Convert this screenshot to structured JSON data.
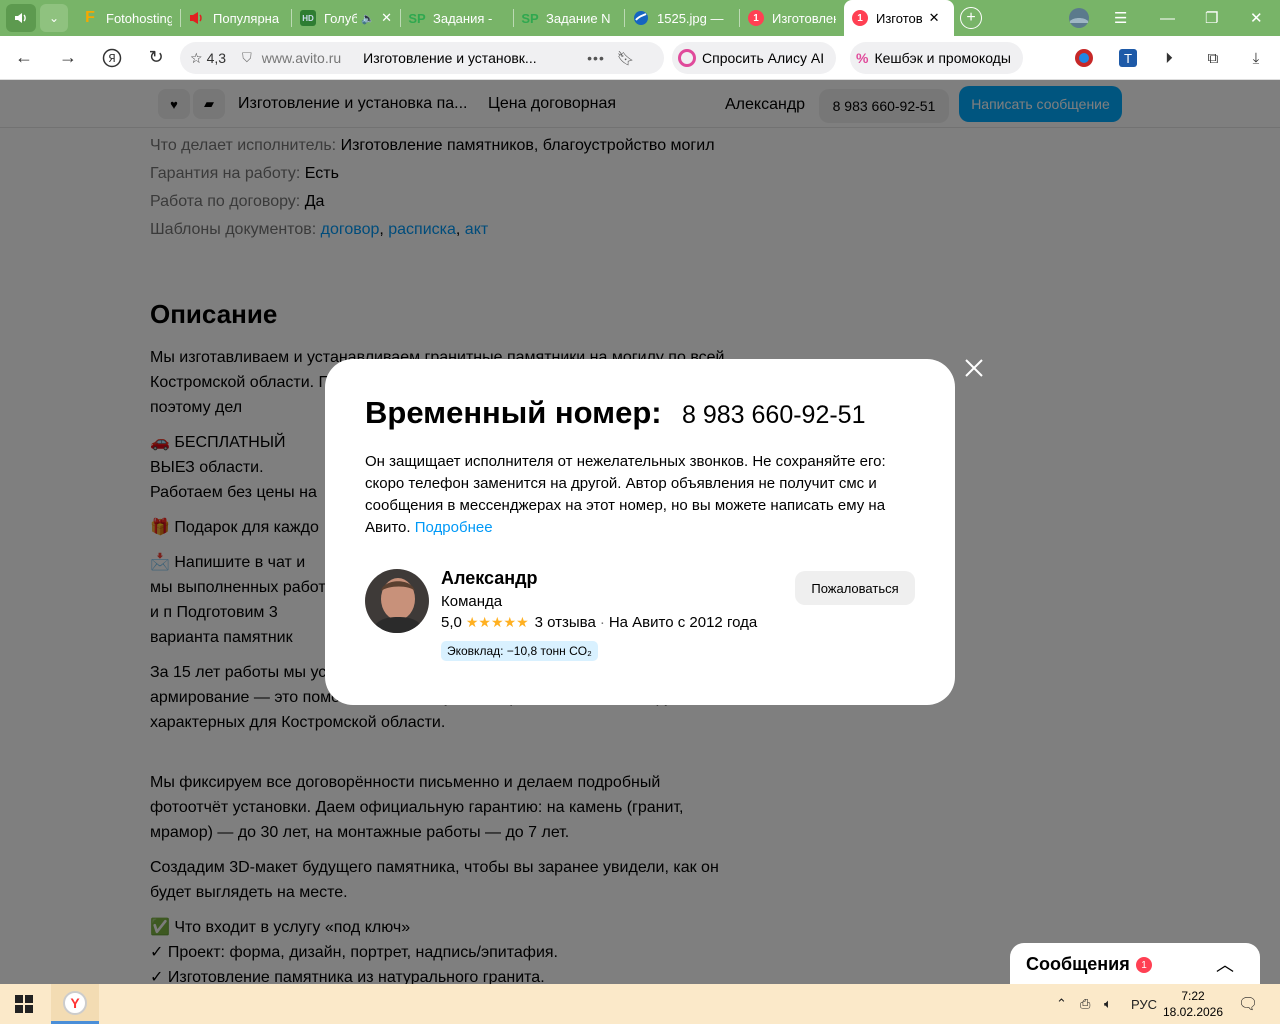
{
  "browser": {
    "tabs": [
      {
        "label": "Fotohosting",
        "favicon": "F",
        "color": "#f6a800"
      },
      {
        "label": "Популярна",
        "favicon": "speaker",
        "color": "#e02020"
      },
      {
        "label": "Голуб",
        "favicon": "HD",
        "color": "#2e7d32"
      },
      {
        "label": "Задания - ",
        "favicon": "SP",
        "color": "#2fa84f"
      },
      {
        "label": "Задание N",
        "favicon": "SP",
        "color": "#2fa84f"
      },
      {
        "label": "1525.jpg —",
        "favicon": "wave",
        "color": "#1565c0"
      },
      {
        "label": "Изготовлен",
        "favicon": "1",
        "color": "#ff4053"
      },
      {
        "label": "Изготов",
        "favicon": "1",
        "color": "#ff4053",
        "active": true
      }
    ],
    "rating": "4,3",
    "domain": "www.avito.ru",
    "page_title": "Изготовление и установк...",
    "alisa_label": "Спросить Алису AI",
    "cashback_label": "Кешбэк и промокоды"
  },
  "sticky": {
    "title": "Изготовление и установка па...",
    "price": "Цена договорная",
    "seller": "Александр",
    "phone": "8 983 660-92-51",
    "write_label": "Написать сообщение"
  },
  "props": [
    {
      "key": "Что делает исполнитель:",
      "value": "Изготовление памятников, благоустройство могил"
    },
    {
      "key": "Гарантия на работу:",
      "value": "Есть"
    },
    {
      "key": "Работа по договору:",
      "value": "Да"
    }
  ],
  "templates": {
    "key": "Шаблоны документов:",
    "links": [
      "договор",
      "расписка",
      "акт"
    ]
  },
  "description": {
    "heading": "Описание",
    "p1": "Мы изготавливаем и устанавливаем гранитные памятники на могилу по всей Костромской области. Понимаем, насколько важно принять правильное решение, поэтому дел",
    "p2": "🚗 БЕСПЛАТНЫЙ ВЫЕЗ области. Работаем без цены на ~20% сохрани",
    "p3": "🎁 Подарок для каждо",
    "p4": "📩 Напишите в чат и мы выполненных работ и п Подготовим 3 варианта памятник достойным, н",
    "p5": "За 15 лет работы мы ус аккуратным монтажом, Используем усиленную заливку и армирование — это помогает памятнику стоять ровно на сложных грунтах, характерных для Костромской области.",
    "p6": "Мы фиксируем все договорённости письменно и делаем подробный фотоотчёт установки. Даем официальную гарантию: на камень (гранит, мрамор) — до 30 лет, на монтажные работы — до 7 лет.",
    "p7": "Создадим 3D-макет будущего памятника, чтобы вы заранее увидели, как он будет выглядеть на месте.",
    "list_title": "✅ Что входит в услугу «под ключ»",
    "list": [
      "✓ Проект: форма, дизайн, портрет, надпись/эпитафия.",
      "✓ Изготовление памятника из натурального гранита."
    ]
  },
  "modal": {
    "title": "Временный номер:",
    "phone": "8 983 660-92-51",
    "text": "Он защищает исполнителя от нежелательных звонков. Не сохраняйте его: скоро телефон заменится на другой. Автор объявления не получит смс и сообщения в мессенджерах на этот номер, но вы можете написать ему на Авито.",
    "more_link": "Подробнее",
    "seller_name": "Александр",
    "seller_type": "Команда",
    "rating": "5,0",
    "stars": 5,
    "reviews": "3 отзыва",
    "since": "На Авито с 2012 года",
    "eco": "Эковклад: −10,8 тонн CO₂",
    "complain_label": "Пожаловаться"
  },
  "messages": {
    "label": "Сообщения",
    "count": "1"
  },
  "taskbar": {
    "lang": "РУС",
    "time": "7:22",
    "date": "18.02.2026"
  },
  "colors": {
    "accent": "#00aaff",
    "link": "#0099f7",
    "tabbar": "#78b468",
    "taskbar": "#fbe9c9",
    "star": "#ffb021",
    "badge": "#ff4053"
  }
}
